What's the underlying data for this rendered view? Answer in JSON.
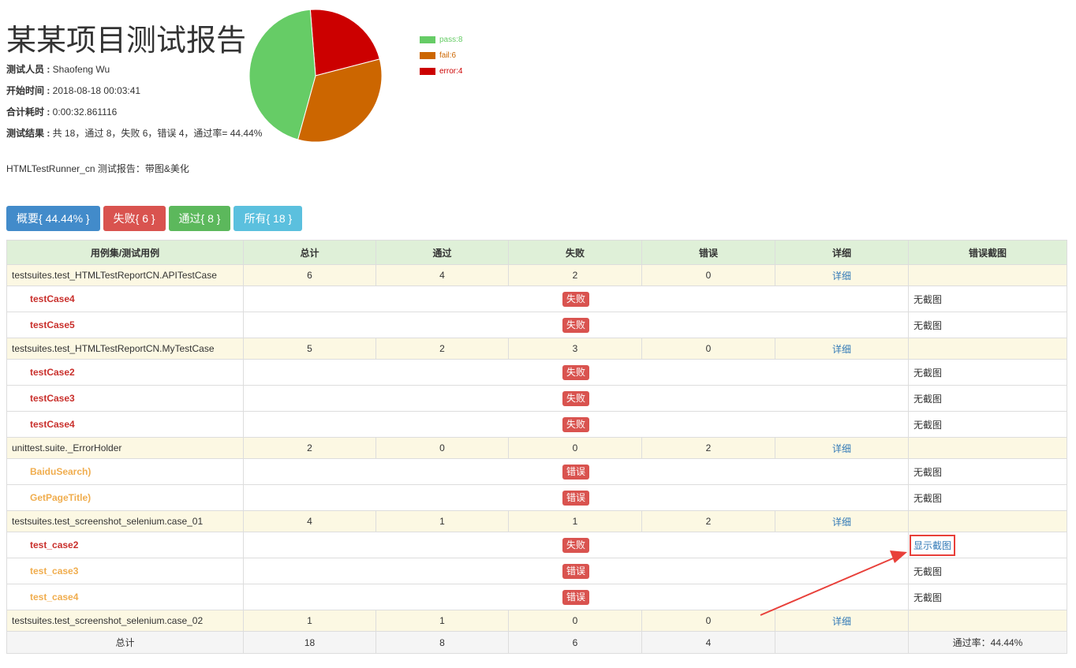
{
  "report": {
    "title": "某某项目测试报告",
    "meta": [
      {
        "label": "测试人员 : ",
        "value": "Shaofeng Wu"
      },
      {
        "label": "开始时间 : ",
        "value": "2018-08-18 00:03:41"
      },
      {
        "label": "合计耗时 : ",
        "value": "0:00:32.861116"
      },
      {
        "label": "测试结果 : ",
        "value": "共 18，通过 8，失败 6，错误 4，通过率= 44.44%"
      }
    ],
    "description": "HTMLTestRunner_cn 测试报告：带图&美化"
  },
  "pie": {
    "legend": [
      {
        "label": "pass:8",
        "color": "#66cc66",
        "value": 8
      },
      {
        "label": "fail:6",
        "color": "#cc6600",
        "value": 6
      },
      {
        "label": "error:4",
        "color": "#cc0000",
        "value": 4
      }
    ]
  },
  "filters": [
    {
      "label": "概要{ 44.44% }",
      "color": "#428bca"
    },
    {
      "label": "失败{ 6 }",
      "color": "#d9534f"
    },
    {
      "label": "通过{ 8 }",
      "color": "#5cb85c"
    },
    {
      "label": "所有{ 18 }",
      "color": "#5bc0de"
    }
  ],
  "table": {
    "headers": [
      "用例集/测试用例",
      "总计",
      "通过",
      "失败",
      "错误",
      "详细",
      "错误截图"
    ],
    "detail_label": "详细",
    "suites": [
      {
        "name": "testsuites.test_HTMLTestReportCN.APITestCase",
        "total": "6",
        "pass": "4",
        "fail": "2",
        "error": "0",
        "cases": [
          {
            "name": "testCase4",
            "status": "失败",
            "kind": "fail",
            "shot": "无截图",
            "shot_link": false
          },
          {
            "name": "testCase5",
            "status": "失败",
            "kind": "fail",
            "shot": "无截图",
            "shot_link": false
          }
        ]
      },
      {
        "name": "testsuites.test_HTMLTestReportCN.MyTestCase",
        "total": "5",
        "pass": "2",
        "fail": "3",
        "error": "0",
        "cases": [
          {
            "name": "testCase2",
            "status": "失败",
            "kind": "fail",
            "shot": "无截图",
            "shot_link": false
          },
          {
            "name": "testCase3",
            "status": "失败",
            "kind": "fail",
            "shot": "无截图",
            "shot_link": false
          },
          {
            "name": "testCase4",
            "status": "失败",
            "kind": "fail",
            "shot": "无截图",
            "shot_link": false
          }
        ]
      },
      {
        "name": "unittest.suite._ErrorHolder",
        "total": "2",
        "pass": "0",
        "fail": "0",
        "error": "2",
        "cases": [
          {
            "name": "BaiduSearch)",
            "status": "错误",
            "kind": "error",
            "shot": "无截图",
            "shot_link": false
          },
          {
            "name": "GetPageTitle)",
            "status": "错误",
            "kind": "error",
            "shot": "无截图",
            "shot_link": false
          }
        ]
      },
      {
        "name": "testsuites.test_screenshot_selenium.case_01",
        "total": "4",
        "pass": "1",
        "fail": "1",
        "error": "2",
        "cases": [
          {
            "name": "test_case2",
            "status": "失败",
            "kind": "fail",
            "shot": "显示截图",
            "shot_link": true
          },
          {
            "name": "test_case3",
            "status": "错误",
            "kind": "error",
            "shot": "无截图",
            "shot_link": false
          },
          {
            "name": "test_case4",
            "status": "错误",
            "kind": "error",
            "shot": "无截图",
            "shot_link": false
          }
        ]
      },
      {
        "name": "testsuites.test_screenshot_selenium.case_02",
        "total": "1",
        "pass": "1",
        "fail": "0",
        "error": "0",
        "cases": []
      }
    ],
    "total_row": {
      "label": "总计",
      "total": "18",
      "pass": "8",
      "fail": "6",
      "error": "4",
      "rate": "通过率：44.44%"
    }
  },
  "colors": {
    "fail_text": "#c9302c",
    "error_text": "#f0ad4e",
    "badge": "#d9534f",
    "link": "#337ab7",
    "annotation": "#e8403a"
  }
}
